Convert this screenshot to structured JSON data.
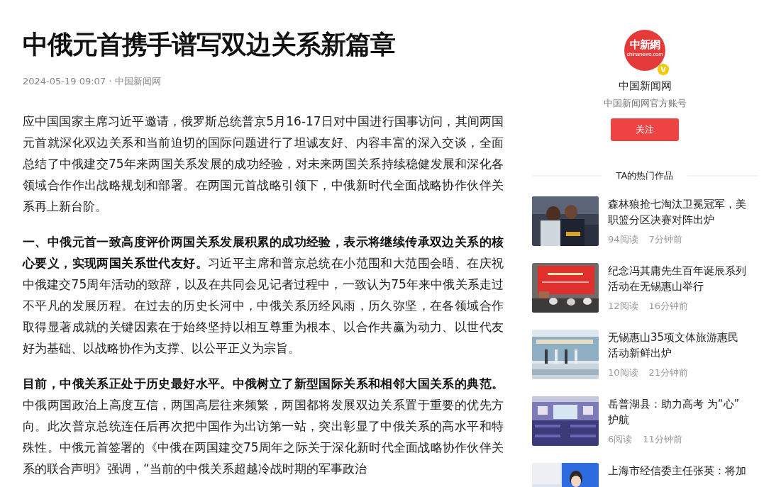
{
  "article": {
    "title": "中俄元首携手谱写双边关系新篇章",
    "meta": "2024-05-19 09:07 · 中国新闻网",
    "paragraphs": [
      "应中国国家主席习近平邀请，俄罗斯总统普京5月16-17日对中国进行国事访问，其间两国元首就深化双边关系和当前迫切的国际问题进行了坦诚友好、内容丰富的深入交谈，全面总结了中俄建交75年来两国关系发展的成功经验，对未来两国关系持续稳健发展和深化各领域合作作出战略规划和部署。在两国元首战略引领下，中俄新时代全面战略协作伙伴关系再上新台阶。",
      "**一、中俄元首一致高度评价两国关系发展积累的成功经验，表示将继续传承双边关系的核心要义，实现两国关系世代友好。**习近平主席和普京总统在小范围和大范围会晤、在庆祝中俄建交75周年活动的致辞，以及在共同会见记者过程中，一致认为75年来中俄关系走过不平凡的发展历程。在过去的历史长河中，中俄关系历经风雨，历久弥坚，在各领域合作取得显著成就的关键因素在于始终坚持以相互尊重为根本、以合作共赢为动力、以世代友好为基础、以战略协作为支撑、以公平正义为宗旨。",
      "**目前，中俄关系正处于历史最好水平。中俄树立了新型国际关系和相邻大国关系的典范。**中俄两国政治上高度互信，两国高层往来频繁，两国都将发展双边关系置于重要的优先方向。此次普京总统连任后再次把中国作为出访第一站，突出彰显了中俄关系的高水平和特殊性。中俄元首签署的《中俄在两国建交75周年之际关于深化新时代全面战略协作伙伴关系的联合声明》强调，“当前的中俄关系超越冷战时期的军事政治"
    ]
  },
  "author": {
    "logo_text": "中新網",
    "logo_sub": "chinanews.com",
    "verified": true,
    "verified_mark": "V",
    "name": "中国新闻网",
    "description": "中国新闻网官方账号",
    "follow_button": "关注"
  },
  "hot_works": {
    "heading": "TA的热门作品",
    "items": [
      {
        "title": "森林狼抢七淘汰卫冕冠军，美职篮分区决赛对阵出炉",
        "reads": "94阅读",
        "time": "7分钟前",
        "kind": "picture"
      },
      {
        "title": "纪念冯其庸先生百年诞辰系列活动在无锡惠山举行",
        "reads": "12阅读",
        "time": "16分钟前",
        "kind": "picture"
      },
      {
        "title": "无锡惠山35项文体旅游惠民活动新鲜出炉",
        "reads": "10阅读",
        "time": "21分钟前",
        "kind": "picture"
      },
      {
        "title": "岳普湖县：助力高考 为“心”护航",
        "reads": "6阅读",
        "time": "11分钟前",
        "kind": "picture"
      },
      {
        "title": "上海市经信委主任张英：将加",
        "kind": "picture"
      }
    ]
  }
}
